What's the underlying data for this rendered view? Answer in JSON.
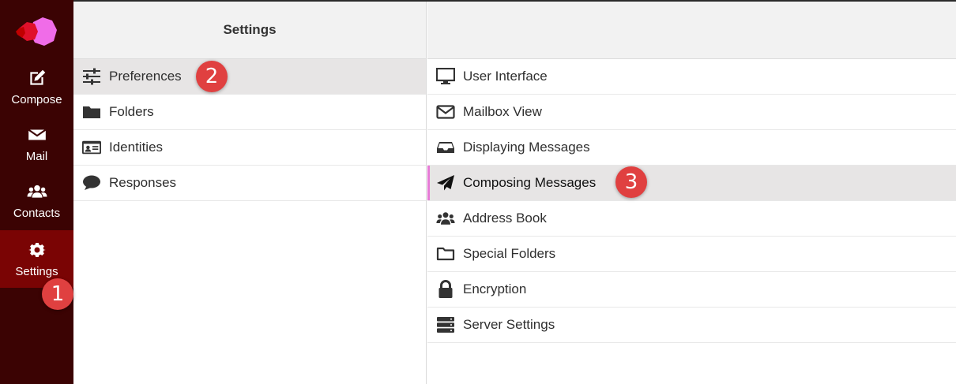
{
  "nav": {
    "items": [
      {
        "label": "Compose",
        "icon": "compose-icon"
      },
      {
        "label": "Mail",
        "icon": "mail-icon"
      },
      {
        "label": "Contacts",
        "icon": "contacts-icon"
      },
      {
        "label": "Settings",
        "icon": "gear-icon",
        "active": true
      }
    ]
  },
  "settings": {
    "title": "Settings",
    "items": [
      {
        "label": "Preferences",
        "icon": "sliders-icon",
        "selected": true
      },
      {
        "label": "Folders",
        "icon": "folder-icon"
      },
      {
        "label": "Identities",
        "icon": "id-card-icon"
      },
      {
        "label": "Responses",
        "icon": "comment-icon"
      }
    ]
  },
  "sections": {
    "items": [
      {
        "label": "User Interface",
        "icon": "monitor-icon"
      },
      {
        "label": "Mailbox View",
        "icon": "envelope-icon"
      },
      {
        "label": "Displaying Messages",
        "icon": "inbox-icon"
      },
      {
        "label": "Composing Messages",
        "icon": "paper-plane-icon",
        "selected": true
      },
      {
        "label": "Address Book",
        "icon": "users-icon"
      },
      {
        "label": "Special Folders",
        "icon": "folder-outline-icon"
      },
      {
        "label": "Encryption",
        "icon": "lock-icon"
      },
      {
        "label": "Server Settings",
        "icon": "server-icon"
      }
    ]
  },
  "callouts": [
    "1",
    "2",
    "3"
  ],
  "colors": {
    "nav_bg": "#3b0303",
    "nav_active": "#7a0404",
    "badge": "#e04040",
    "selection_accent": "#e67bd6"
  }
}
